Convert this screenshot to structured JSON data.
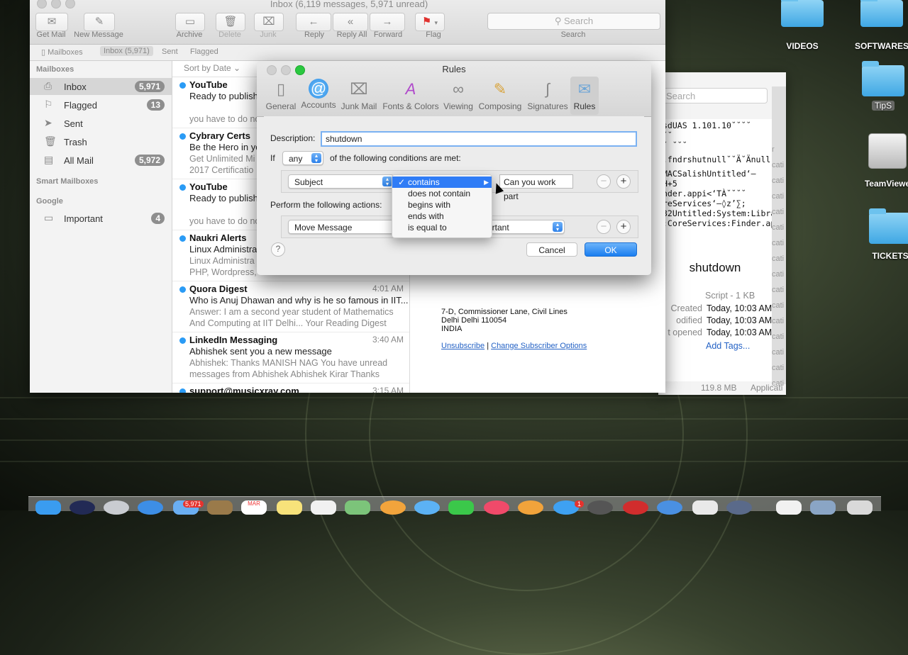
{
  "mail": {
    "window_title": "Inbox (6,119 messages, 5,971 unread)",
    "toolbar": {
      "get_mail": "Get Mail",
      "new_message": "New Message",
      "archive": "Archive",
      "delete": "Delete",
      "junk": "Junk",
      "reply": "Reply",
      "reply_all": "Reply All",
      "forward": "Forward",
      "flag": "Flag",
      "search_placeholder": "Search",
      "search_label": "Search"
    },
    "favorites": [
      "Mailboxes",
      "Inbox (5,971)",
      "Sent",
      "Flagged"
    ],
    "sidebar": {
      "mailboxes_header": "Mailboxes",
      "items": [
        {
          "label": "Inbox",
          "badge": "5,971",
          "icon": "inbox-icon"
        },
        {
          "label": "Flagged",
          "badge": "13",
          "icon": "flag-icon"
        },
        {
          "label": "Sent",
          "badge": "",
          "icon": "sent-icon"
        },
        {
          "label": "Trash",
          "badge": "",
          "icon": "trash-icon"
        },
        {
          "label": "All Mail",
          "badge": "5,972",
          "icon": "tray-icon"
        }
      ],
      "smart_header": "Smart Mailboxes",
      "google_header": "Google",
      "google_items": [
        {
          "label": "Important",
          "badge": "4",
          "icon": "folder-icon"
        }
      ]
    },
    "sort_label": "Sort by Date",
    "messages": [
      {
        "from": "YouTube",
        "time": "",
        "subject": "Ready to publish yo",
        "preview": "you have to do no"
      },
      {
        "from": "Cybrary Certs",
        "time": "",
        "subject": "Be the Hero in yo",
        "preview": "Get Unlimited Mi 2017 Certificatio"
      },
      {
        "from": "YouTube",
        "time": "",
        "subject": "Ready to publish",
        "preview": "you have to do no"
      },
      {
        "from": "Naukri Alerts",
        "time": "",
        "subject": "Linux Administra",
        "preview": "Linux Administra PHP, Wordpress, J"
      },
      {
        "from": "Quora Digest",
        "time": "4:01 AM",
        "subject": "Who is Anuj Dhawan and why is he so famous in IIT...",
        "preview": "Answer: I am a second year student of Mathematics And Computing at IIT Delhi... Your Reading Digest To..."
      },
      {
        "from": "LinkedIn Messaging",
        "time": "3:40 AM",
        "subject": "Abhishek sent you a new message",
        "preview": "Abhishek: Thanks MANISH NAG You have unread messages from Abhishek Abhishek Kirar Thanks Repl..."
      },
      {
        "from": "support@musicxray.com",
        "time": "3:15 AM",
        "subject": "",
        "preview": ""
      }
    ],
    "body": {
      "address_1": "7-D, Commissioner Lane, Civil Lines",
      "address_2": "Delhi Delhi 110054",
      "address_3": "INDIA",
      "unsubscribe": "Unsubscribe",
      "separator": "|",
      "change_options": "Change Subscriber Options"
    }
  },
  "rules": {
    "title": "Rules",
    "tabs": [
      {
        "label": "General",
        "icon": "switch-icon"
      },
      {
        "label": "Accounts",
        "icon": "at-icon"
      },
      {
        "label": "Junk Mail",
        "icon": "junk-icon"
      },
      {
        "label": "Fonts & Colors",
        "icon": "fonts-icon"
      },
      {
        "label": "Viewing",
        "icon": "glasses-icon"
      },
      {
        "label": "Composing",
        "icon": "pencil-icon"
      },
      {
        "label": "Signatures",
        "icon": "signature-icon"
      },
      {
        "label": "Rules",
        "icon": "rules-icon"
      }
    ],
    "description_label": "Description:",
    "description_value": "shutdown",
    "if_label": "If",
    "if_value": "any",
    "conditions_text": "of the following conditions are met:",
    "condition_field": "Subject",
    "condition_operator": "contains",
    "condition_value": "Can you work part",
    "actions_label": "Perform the following actions:",
    "action": "Move Message",
    "action_target": "ortant",
    "help": "?",
    "cancel": "Cancel",
    "ok": "OK",
    "dropdown_options": [
      "contains",
      "does not contain",
      "begins with",
      "ends with",
      "is equal to"
    ],
    "dropdown_selected": "contains"
  },
  "finder": {
    "search_placeholder": "Search",
    "lines": [
      "sdUAS 1.101.10˘˘˘˘",
      "˘˘",
      "˘ ˘˘˘",
      ".fndrshutnull˘˘Ä˘Änull",
      "MACSalishUntitled‘—",
      "H+5",
      "nder.appi<‘TÀ˘˘˘˘",
      "reServices‘—◊z’∑;",
      "32Untitled:System:Libra",
      ":CoreServices:Finder.ap"
    ],
    "side_labels": [
      "r",
      "cati",
      "cati",
      "cati",
      "cati",
      "cati",
      "cati",
      "cati",
      "cati",
      "cati",
      "cati",
      "cati",
      "cati",
      "cati",
      "cati",
      "cati"
    ],
    "file_name": "shutdown",
    "file_kind": "Script - 1 KB",
    "created_label": "Created",
    "created_value": "Today, 10:03 AM",
    "modified_label": "odified",
    "modified_value": "Today, 10:03 AM",
    "opened_label": "t opened",
    "opened_value": "Today, 10:03 AM",
    "add_tags": "Add Tags...",
    "status_size": "119.8 MB",
    "status_kind": "Applicati"
  },
  "desktop": {
    "items": [
      "VIDEOS",
      "SOFTWARES",
      "TipS",
      "TeamViewe",
      "TICKETS"
    ]
  },
  "dock": {
    "mail_badge": "5,971",
    "calendar_label": "MAR",
    "app_badge": "1"
  }
}
